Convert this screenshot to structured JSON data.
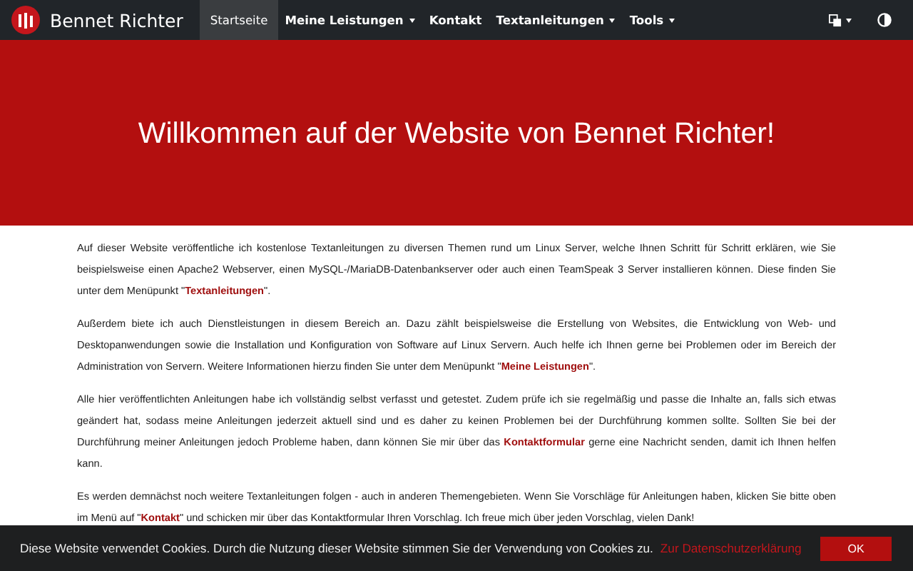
{
  "navbar": {
    "brand": "Bennet Richter",
    "items": [
      {
        "label": "Startseite",
        "selected": true,
        "dropdown": false
      },
      {
        "label": "Meine Leistungen",
        "selected": false,
        "dropdown": true
      },
      {
        "label": "Kontakt",
        "selected": false,
        "dropdown": false
      },
      {
        "label": "Textanleitungen",
        "selected": false,
        "dropdown": true
      },
      {
        "label": "Tools",
        "selected": false,
        "dropdown": true
      }
    ]
  },
  "hero": {
    "title": "Willkommen auf der Website von Bennet Richter!"
  },
  "paragraphs": [
    {
      "before": "Auf dieser Website veröffentliche ich kostenlose Textanleitungen zu diversen Themen rund um Linux Server, welche Ihnen Schritt für Schritt erklären, wie Sie beispielsweise einen Apache2 Webserver, einen MySQL-/MariaDB-Datenbankserver oder auch einen TeamSpeak 3 Server installieren können. Diese finden Sie unter dem Menüpunkt \"",
      "link": "Textanleitungen",
      "after": "\"."
    },
    {
      "before": "Außerdem biete ich auch Dienstleistungen in diesem Bereich an. Dazu zählt beispielsweise die Erstellung von Websites, die Entwicklung von Web- und Desktopanwendungen sowie die Installation und Konfiguration von Software auf Linux Servern. Auch helfe ich Ihnen gerne bei Problemen oder im Bereich der Administration von Servern. Weitere Informationen hierzu finden Sie unter dem Menüpunkt \"",
      "link": "Meine Leistungen",
      "after": "\"."
    },
    {
      "before": "Alle hier veröffentlichten Anleitungen habe ich vollständig selbst verfasst und getestet. Zudem prüfe ich sie regelmäßig und passe die Inhalte an, falls sich etwas geändert hat, sodass meine Anleitungen jederzeit aktuell sind und es daher zu keinen Problemen bei der Durchführung kommen sollte. Sollten Sie bei der Durchführung meiner Anleitungen jedoch Probleme haben, dann können Sie mir über das ",
      "link": "Kontaktformular",
      "after": " gerne eine Nachricht senden, damit ich Ihnen helfen kann."
    },
    {
      "before": "Es werden demnächst noch weitere Textanleitungen folgen - auch in anderen Themengebieten. Wenn Sie Vorschläge für Anleitungen haben, klicken Sie bitte oben im Menü auf \"",
      "link": "Kontakt",
      "after": "\" und schicken mir über das Kontaktformular Ihren Vorschlag. Ich freue mich über jeden Vorschlag, vielen Dank!"
    }
  ],
  "cookie_banner": {
    "text": "Diese Website verwendet Cookies. Durch die Nutzung dieser Website stimmen Sie der Verwendung von Cookies zu.",
    "link": "Zur Datenschutzerklärung",
    "button": "OK"
  }
}
